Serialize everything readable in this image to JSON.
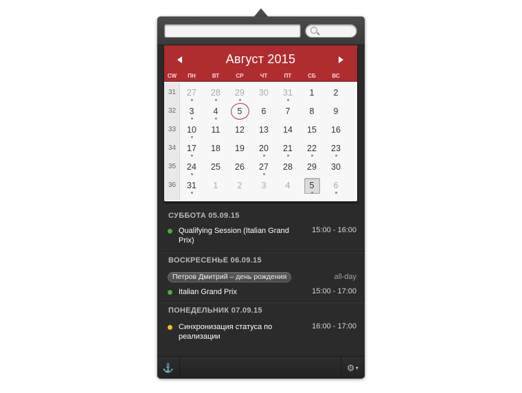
{
  "search": {
    "event_placeholder": "",
    "search_placeholder": ""
  },
  "calendar": {
    "month_title": "Август 2015",
    "weekday_headers": [
      "CW",
      "ПН",
      "ВТ",
      "СР",
      "ЧТ",
      "ПТ",
      "СБ",
      "ВС"
    ],
    "weeks": [
      {
        "cw": "31",
        "days": [
          {
            "d": "27",
            "muted": true,
            "dot": true
          },
          {
            "d": "28",
            "muted": true,
            "dot": true
          },
          {
            "d": "29",
            "muted": true,
            "dot": true
          },
          {
            "d": "30",
            "muted": true,
            "dot": false
          },
          {
            "d": "31",
            "muted": true,
            "dot": true
          },
          {
            "d": "1",
            "muted": false,
            "dot": false
          },
          {
            "d": "2",
            "muted": false,
            "dot": false
          }
        ]
      },
      {
        "cw": "32",
        "days": [
          {
            "d": "3",
            "muted": false,
            "dot": true
          },
          {
            "d": "4",
            "muted": false,
            "dot": true
          },
          {
            "d": "5",
            "muted": false,
            "dot": false,
            "today": true
          },
          {
            "d": "6",
            "muted": false,
            "dot": false
          },
          {
            "d": "7",
            "muted": false,
            "dot": false
          },
          {
            "d": "8",
            "muted": false,
            "dot": false
          },
          {
            "d": "9",
            "muted": false,
            "dot": false
          }
        ]
      },
      {
        "cw": "33",
        "days": [
          {
            "d": "10",
            "muted": false,
            "dot": true
          },
          {
            "d": "11",
            "muted": false,
            "dot": false
          },
          {
            "d": "12",
            "muted": false,
            "dot": false
          },
          {
            "d": "13",
            "muted": false,
            "dot": false
          },
          {
            "d": "14",
            "muted": false,
            "dot": false
          },
          {
            "d": "15",
            "muted": false,
            "dot": false
          },
          {
            "d": "16",
            "muted": false,
            "dot": false
          }
        ]
      },
      {
        "cw": "34",
        "days": [
          {
            "d": "17",
            "muted": false,
            "dot": true
          },
          {
            "d": "18",
            "muted": false,
            "dot": false
          },
          {
            "d": "19",
            "muted": false,
            "dot": false
          },
          {
            "d": "20",
            "muted": false,
            "dot": true
          },
          {
            "d": "21",
            "muted": false,
            "dot": true
          },
          {
            "d": "22",
            "muted": false,
            "dot": true
          },
          {
            "d": "23",
            "muted": false,
            "dot": true
          }
        ]
      },
      {
        "cw": "35",
        "days": [
          {
            "d": "24",
            "muted": false,
            "dot": true
          },
          {
            "d": "25",
            "muted": false,
            "dot": false
          },
          {
            "d": "26",
            "muted": false,
            "dot": false
          },
          {
            "d": "27",
            "muted": false,
            "dot": true
          },
          {
            "d": "28",
            "muted": false,
            "dot": false
          },
          {
            "d": "29",
            "muted": false,
            "dot": false
          },
          {
            "d": "30",
            "muted": false,
            "dot": false
          }
        ]
      },
      {
        "cw": "36",
        "days": [
          {
            "d": "31",
            "muted": false,
            "dot": true
          },
          {
            "d": "1",
            "muted": true,
            "dot": false
          },
          {
            "d": "2",
            "muted": true,
            "dot": false
          },
          {
            "d": "3",
            "muted": true,
            "dot": false
          },
          {
            "d": "4",
            "muted": true,
            "dot": false
          },
          {
            "d": "5",
            "muted": false,
            "dot": true,
            "selected": true
          },
          {
            "d": "6",
            "muted": true,
            "dot": true
          }
        ]
      }
    ]
  },
  "events": {
    "saturday": {
      "header": "СУББОТА 05.09.15",
      "items": [
        {
          "title": "Qualifying Session (Italian Grand Prix)",
          "time": "15:00 - 16:00",
          "color": "#4caf3a"
        }
      ]
    },
    "sunday": {
      "header": "ВОСКРЕСЕНЬЕ 06.09.15",
      "birthday": {
        "title": "Петров Дмитрий – день рождения",
        "time": "all-day"
      },
      "items": [
        {
          "title": "Italian Grand Prix",
          "time": "15:00 - 17:00",
          "color": "#4caf3a"
        }
      ]
    },
    "monday": {
      "header": "ПОНЕДЕЛЬНИК 07.09.15",
      "items": [
        {
          "title": "Синхронизация статуса по реализации",
          "time": "16:00 - 17:00",
          "color": "#f0c020"
        }
      ]
    }
  },
  "bottom_bar": {
    "left_icon": "anchor-icon",
    "right_icon": "gear-icon"
  },
  "colors": {
    "header_red": "#b22f33",
    "panel_dark": "#2b2b2b",
    "today_ring": "#a8353a"
  }
}
